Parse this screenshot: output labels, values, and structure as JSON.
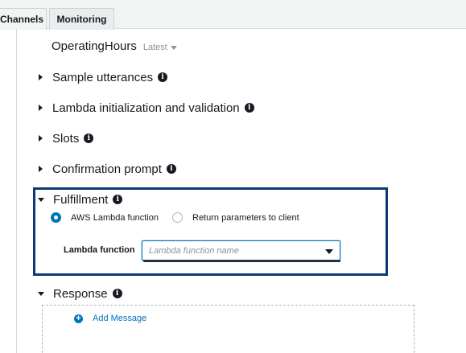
{
  "tabs": [
    {
      "label": "Channels"
    },
    {
      "label": "Monitoring"
    }
  ],
  "intent": {
    "name": "OperatingHours",
    "version": "Latest"
  },
  "sections": {
    "sample_utterances": "Sample utterances",
    "lambda_init": "Lambda initialization and validation",
    "slots": "Slots",
    "confirmation_prompt": "Confirmation prompt",
    "fulfillment": "Fulfillment",
    "response": "Response"
  },
  "fulfillment": {
    "options": [
      {
        "label": "AWS Lambda function",
        "selected": true
      },
      {
        "label": "Return parameters to client",
        "selected": false
      }
    ],
    "lambda_label": "Lambda function",
    "lambda_placeholder": "Lambda function name"
  },
  "response": {
    "add_message": "Add Message"
  },
  "colors": {
    "accent": "#0073bb",
    "highlight_border": "#0b3a73"
  }
}
